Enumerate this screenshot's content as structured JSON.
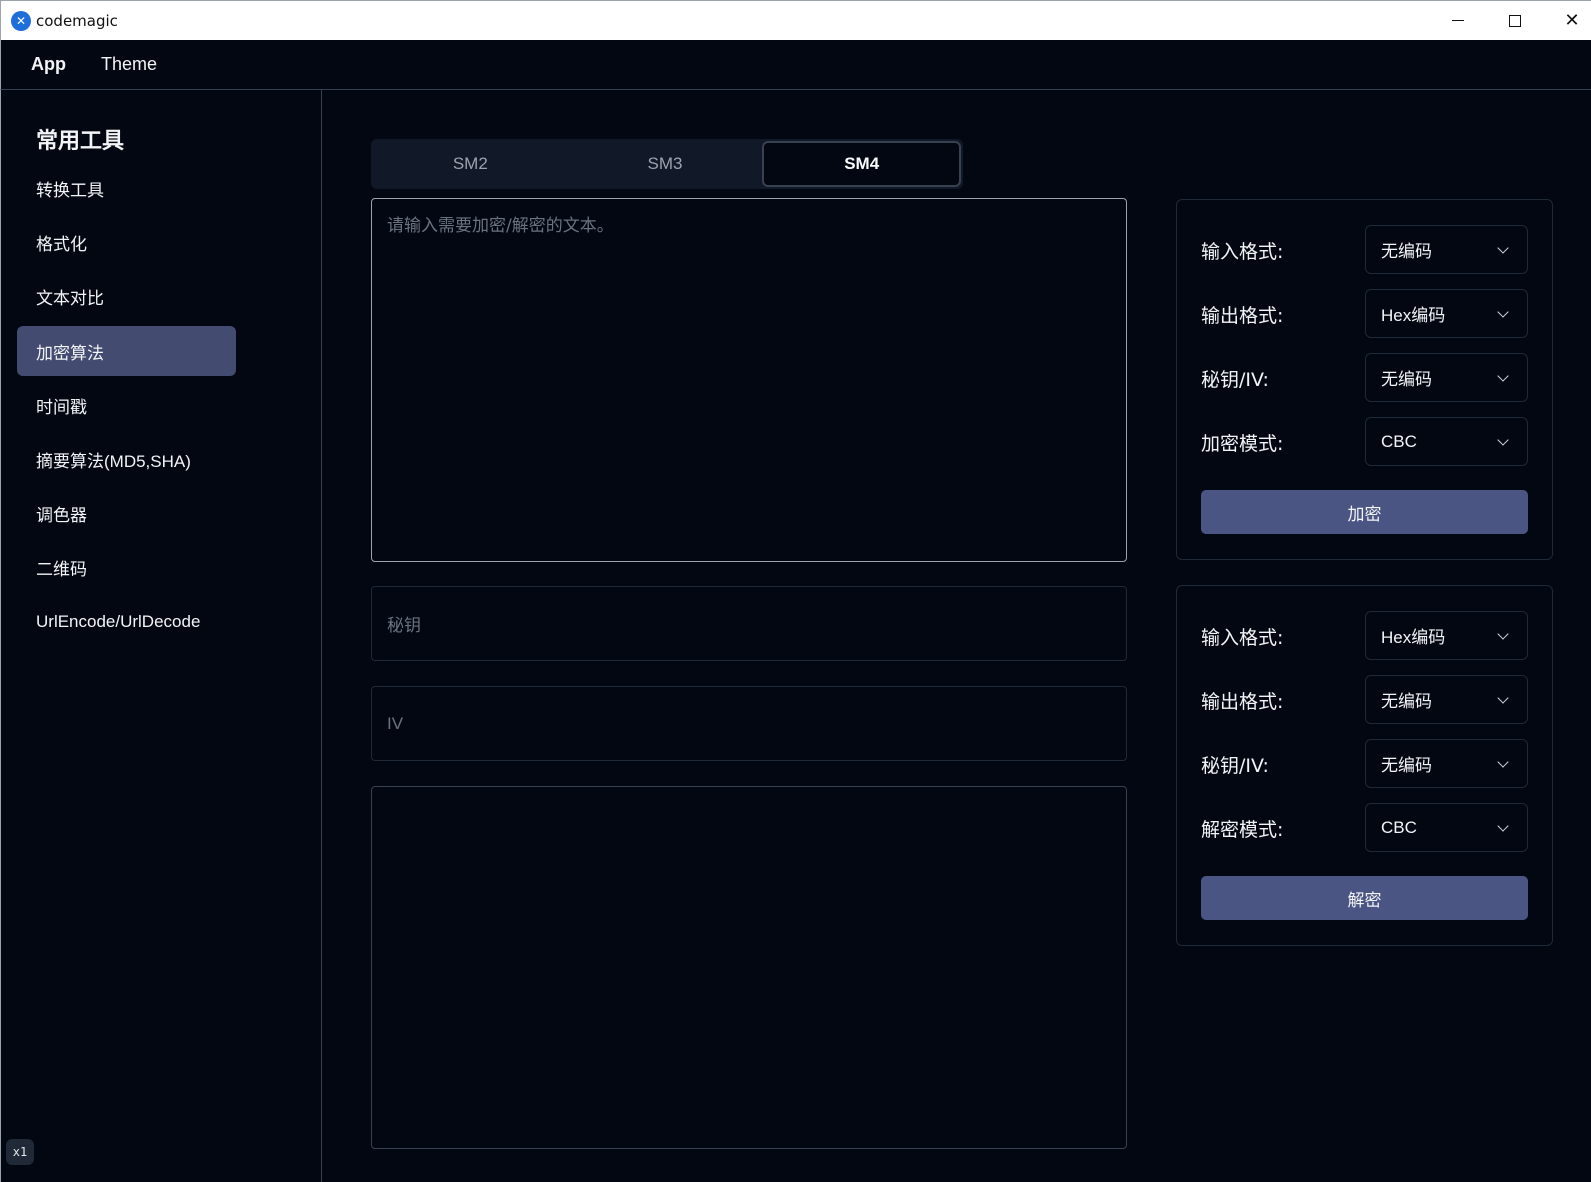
{
  "window": {
    "title": "codemagic",
    "icon_glyph": "✕",
    "close_glyph": "✕"
  },
  "menu": {
    "items": [
      "App",
      "Theme"
    ]
  },
  "sidebar": {
    "heading": "常用工具",
    "items": [
      {
        "label": "转换工具"
      },
      {
        "label": "格式化"
      },
      {
        "label": "文本对比"
      },
      {
        "label": "加密算法",
        "active": true
      },
      {
        "label": "时间戳"
      },
      {
        "label": "摘要算法(MD5,SHA)"
      },
      {
        "label": "调色器"
      },
      {
        "label": "二维码"
      },
      {
        "label": "UrlEncode/UrlDecode"
      }
    ],
    "zoom": "x1"
  },
  "tabs": [
    {
      "label": "SM2"
    },
    {
      "label": "SM3"
    },
    {
      "label": "SM4",
      "active": true
    }
  ],
  "main": {
    "input_placeholder": "请输入需要加密/解密的文本。",
    "key_placeholder": "秘钥",
    "iv_placeholder": "IV",
    "output_value": ""
  },
  "encrypt_panel": {
    "rows": [
      {
        "label": "输入格式:",
        "value": "无编码"
      },
      {
        "label": "输出格式:",
        "value": "Hex编码"
      },
      {
        "label": "秘钥/IV:",
        "value": "无编码"
      },
      {
        "label": "加密模式:",
        "value": "CBC"
      }
    ],
    "button": "加密"
  },
  "decrypt_panel": {
    "rows": [
      {
        "label": "输入格式:",
        "value": "Hex编码"
      },
      {
        "label": "输出格式:",
        "value": "无编码"
      },
      {
        "label": "秘钥/IV:",
        "value": "无编码"
      },
      {
        "label": "解密模式:",
        "value": "CBC"
      }
    ],
    "button": "解密"
  },
  "colors": {
    "background": "#030712",
    "active_item": "#434b70",
    "button": "#4b5584",
    "border": "#374151"
  }
}
